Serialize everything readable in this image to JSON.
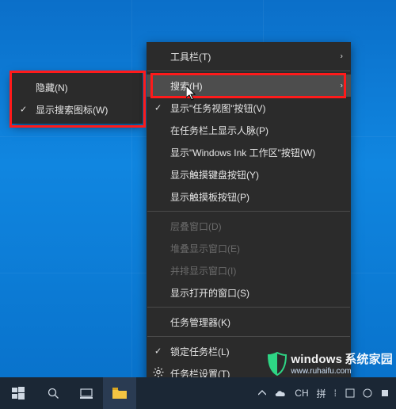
{
  "submenu": {
    "items": [
      {
        "label": "隐藏(N)",
        "checked": false
      },
      {
        "label": "显示搜索图标(W)",
        "checked": true
      }
    ]
  },
  "mainmenu": {
    "groups": [
      [
        {
          "label": "工具栏(T)",
          "submenu": true
        }
      ],
      [
        {
          "label": "搜索(H)",
          "submenu": true,
          "hover": true
        },
        {
          "label": "显示\"任务视图\"按钮(V)",
          "checked": true
        },
        {
          "label": "在任务栏上显示人脉(P)"
        },
        {
          "label": "显示\"Windows Ink 工作区\"按钮(W)"
        },
        {
          "label": "显示触摸键盘按钮(Y)"
        },
        {
          "label": "显示触摸板按钮(P)"
        }
      ],
      [
        {
          "label": "层叠窗口(D)",
          "disabled": true
        },
        {
          "label": "堆叠显示窗口(E)",
          "disabled": true
        },
        {
          "label": "并排显示窗口(I)",
          "disabled": true
        },
        {
          "label": "显示打开的窗口(S)"
        }
      ],
      [
        {
          "label": "任务管理器(K)"
        }
      ],
      [
        {
          "label": "锁定任务栏(L)",
          "checked": true
        },
        {
          "label": "任务栏设置(T)",
          "icon": "gear"
        }
      ]
    ]
  },
  "taskbar": {
    "ime_lang": "CH",
    "ime_mode": "拼"
  },
  "watermark": {
    "brand": "windows",
    "sub": "系统家园",
    "url": "www.ruhaifu.com"
  }
}
